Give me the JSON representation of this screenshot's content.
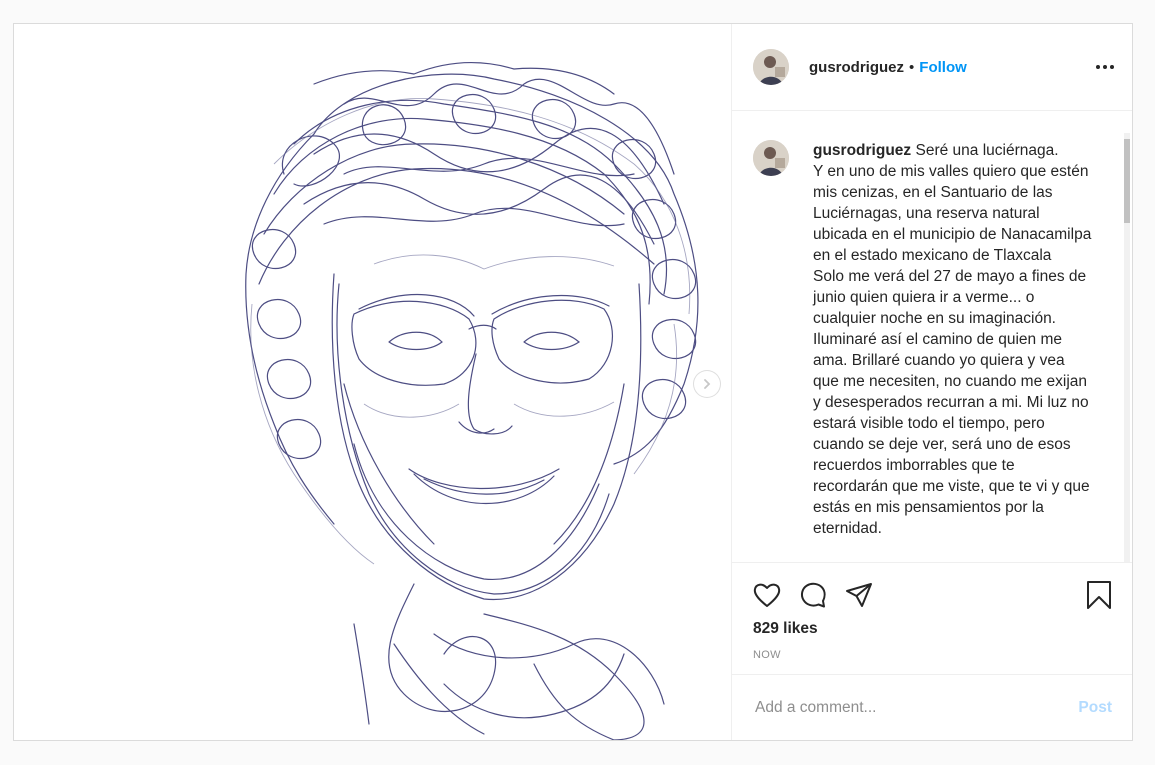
{
  "post": {
    "username": "gusrodriguez",
    "separator": "•",
    "follow_label": "Follow",
    "more_icon": "more-options-icon",
    "caption_user": "gusrodriguez",
    "caption_text": "Seré una luciérnaga.\nY en uno de mis valles quiero que estén mis cenizas, en el Santuario de las Luciérnagas, una reserva natural ubicada en el municipio de Nanacamilpa en el estado mexicano de Tlaxcala\nSolo me verá del 27 de mayo a fines de junio quien quiera ir a verme... o cualquier noche en su imaginación. Iluminaré así el camino de quien me ama. Brillaré cuando yo quiera y vea que me necesiten, no cuando me exijan y desesperados recurran a mi. Mi luz no estará visible todo el tiempo, pero cuando se deje ver, será uno de esos recuerdos imborrables que te recordarán que me viste, que te vi y que estás en mis pensamientos por la eternidad.",
    "likes": "829 likes",
    "timestamp": "NOW",
    "comment_placeholder": "Add a comment...",
    "post_label": "Post"
  },
  "icons": {
    "like": "heart-icon",
    "comment": "comment-bubble-icon",
    "share": "paper-plane-icon",
    "save": "bookmark-icon",
    "next": "chevron-right-icon"
  },
  "colors": {
    "link_blue": "#0095f6",
    "post_disabled": "#b3dbff",
    "ink": "#2e2f6e"
  }
}
